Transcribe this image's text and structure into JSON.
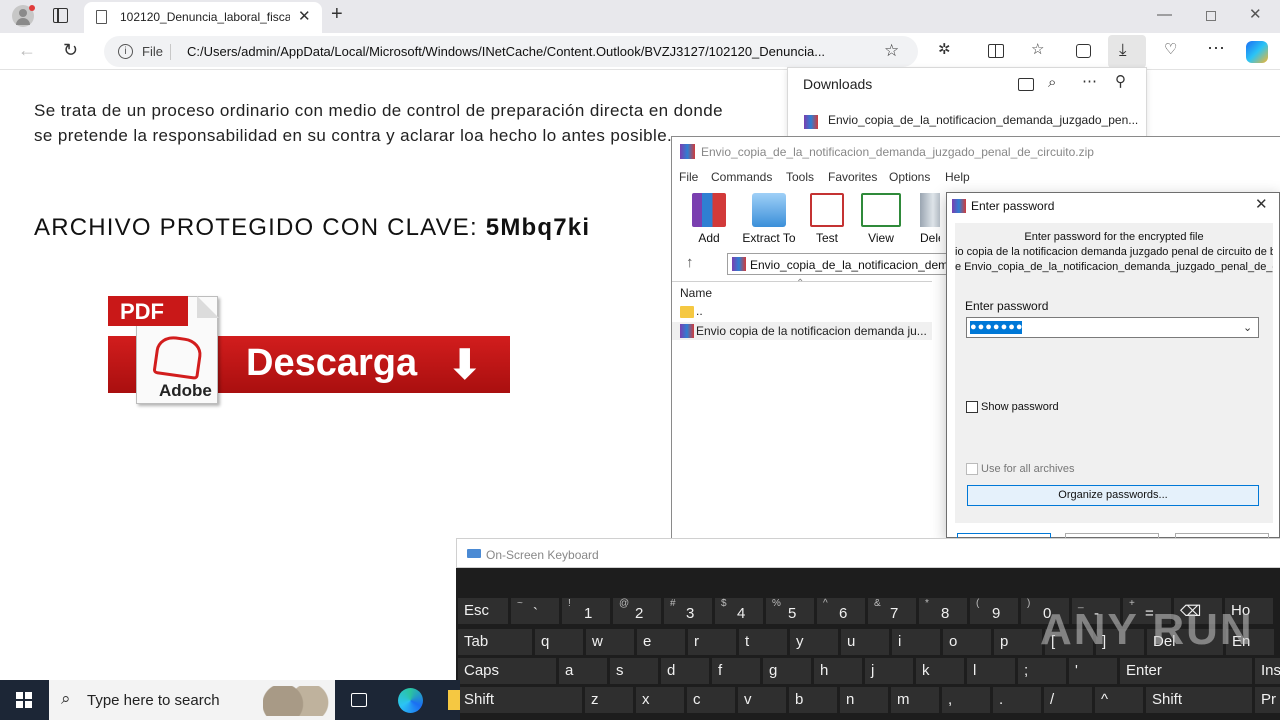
{
  "browser": {
    "tab_title": "102120_Denuncia_laboral_fiscal_",
    "address_scheme": "File",
    "address_url": "C:/Users/admin/AppData/Local/Microsoft/Windows/INetCache/Content.Outlook/BVZJ3127/102120_Denuncia..."
  },
  "page": {
    "paragraph": "Se trata de un proceso ordinario con medio de control de preparación directa en donde se pretende la responsabilidad en su contra y aclarar loa hecho lo antes posible.",
    "protected_label": "ARCHIVO PROTEGIDO CON CLAVE: ",
    "protected_key": "5Mbq7ki",
    "banner_badge": "PDF",
    "banner_logo": "Adobe",
    "banner_text": "Descarga"
  },
  "downloads": {
    "title": "Downloads",
    "item_name": "Envio_copia_de_la_notificacion_demanda_juzgado_pen..."
  },
  "winrar": {
    "title": "Envio_copia_de_la_notificacion_demanda_juzgado_penal_de_circuito.zip",
    "menu": [
      "File",
      "Commands",
      "Tools",
      "Favorites",
      "Options",
      "Help"
    ],
    "tools": [
      "Add",
      "Extract To",
      "Test",
      "View",
      "Delet"
    ],
    "path": "Envio_copia_de_la_notificacion_dema",
    "column_name": "Name",
    "rows": [
      "..",
      "Envio copia de la notificacion demanda ju..."
    ]
  },
  "password_dialog": {
    "title": "Enter password",
    "info_line1": "Enter password for the encrypted file",
    "info_line2": "io copia de la notificacion demanda juzgado penal de circuito de bogo",
    "info_line3": "e Envio_copia_de_la_notificacion_demanda_juzgado_penal_de_circ",
    "field_label": "Enter password",
    "masked_value": "●●●●●●●",
    "show_password": "Show password",
    "use_for_all": "Use for all archives",
    "organize_button": "Organize passwords..."
  },
  "osk": {
    "title": "On-Screen Keyboard",
    "row1": [
      {
        "shift": "",
        "main": "Esc"
      },
      {
        "shift": "~",
        "main": "`"
      },
      {
        "shift": "!",
        "main": "1"
      },
      {
        "shift": "@",
        "main": "2"
      },
      {
        "shift": "#",
        "main": "3"
      },
      {
        "shift": "$",
        "main": "4"
      },
      {
        "shift": "%",
        "main": "5"
      },
      {
        "shift": "^",
        "main": "6"
      },
      {
        "shift": "&",
        "main": "7"
      },
      {
        "shift": "*",
        "main": "8"
      },
      {
        "shift": "(",
        "main": "9"
      },
      {
        "shift": ")",
        "main": "0"
      },
      {
        "shift": "_",
        "main": "-"
      },
      {
        "shift": "+",
        "main": "="
      },
      {
        "shift": "",
        "main": "⌫"
      },
      {
        "shift": "",
        "main": "Ho"
      }
    ],
    "row2": [
      "Tab",
      "q",
      "w",
      "e",
      "r",
      "t",
      "y",
      "u",
      "i",
      "o",
      "p",
      "[",
      "]",
      "Del",
      "En"
    ],
    "row3": [
      "Caps",
      "a",
      "s",
      "d",
      "f",
      "g",
      "h",
      "j",
      "k",
      "l",
      ";",
      "'",
      "Enter",
      "Ins"
    ],
    "row4": [
      "Shift",
      "z",
      "x",
      "c",
      "v",
      "b",
      "n",
      "m",
      ",",
      ".",
      "/",
      "^",
      "Shift",
      "Pr"
    ]
  },
  "taskbar": {
    "search_placeholder": "Type here to search"
  },
  "watermark": "ANY RUN"
}
